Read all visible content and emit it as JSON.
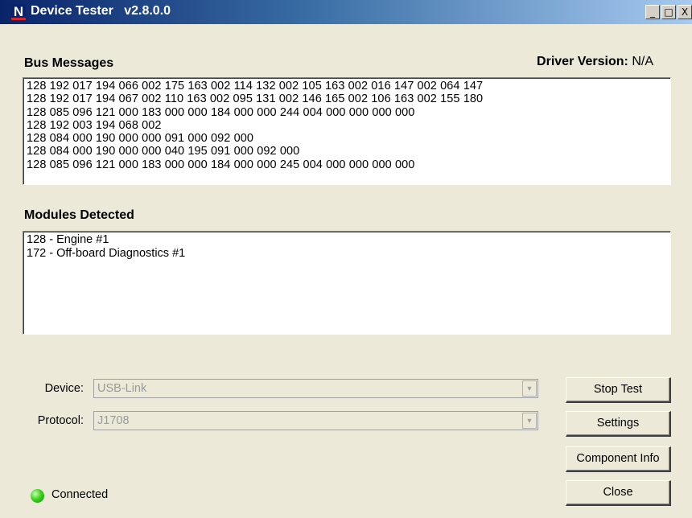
{
  "window": {
    "app_logo": "N",
    "title": "Device Tester   v2.8.0.0",
    "buttons": {
      "minimize": "_",
      "maximize": "□",
      "close": "X"
    }
  },
  "bus_messages": {
    "label": "Bus Messages",
    "driver_version_label": "Driver Version:",
    "driver_version_value": "N/A",
    "lines": [
      "128 192 017 194 066 002 175 163 002 114 132 002 105 163 002 016 147 002 064 147",
      "128 192 017 194 067 002 110 163 002 095 131 002 146 165 002 106 163 002 155 180",
      "128 085 096 121 000 183 000 000 184 000 000 244 004 000 000 000 000",
      "128 192 003 194 068 002",
      "128 084 000 190 000 000 091 000 092 000",
      "128 084 000 190 000 000 040 195 091 000 092 000",
      "128 085 096 121 000 183 000 000 184 000 000 245 004 000 000 000 000"
    ]
  },
  "modules": {
    "label": "Modules Detected",
    "items": [
      "128 - Engine #1",
      "172 - Off-board Diagnostics #1"
    ]
  },
  "device": {
    "label": "Device:",
    "value": "USB-Link"
  },
  "protocol": {
    "label": "Protocol:",
    "value": "J1708"
  },
  "actions": {
    "stop_test": "Stop Test",
    "settings": "Settings",
    "component_info": "Component Info",
    "close": "Close"
  },
  "status": {
    "text": "Connected",
    "color": "#3cd41c"
  },
  "colors": {
    "title_start": "#0a246a",
    "title_end": "#a6caf0",
    "dialog_bg": "#ece9d8"
  }
}
